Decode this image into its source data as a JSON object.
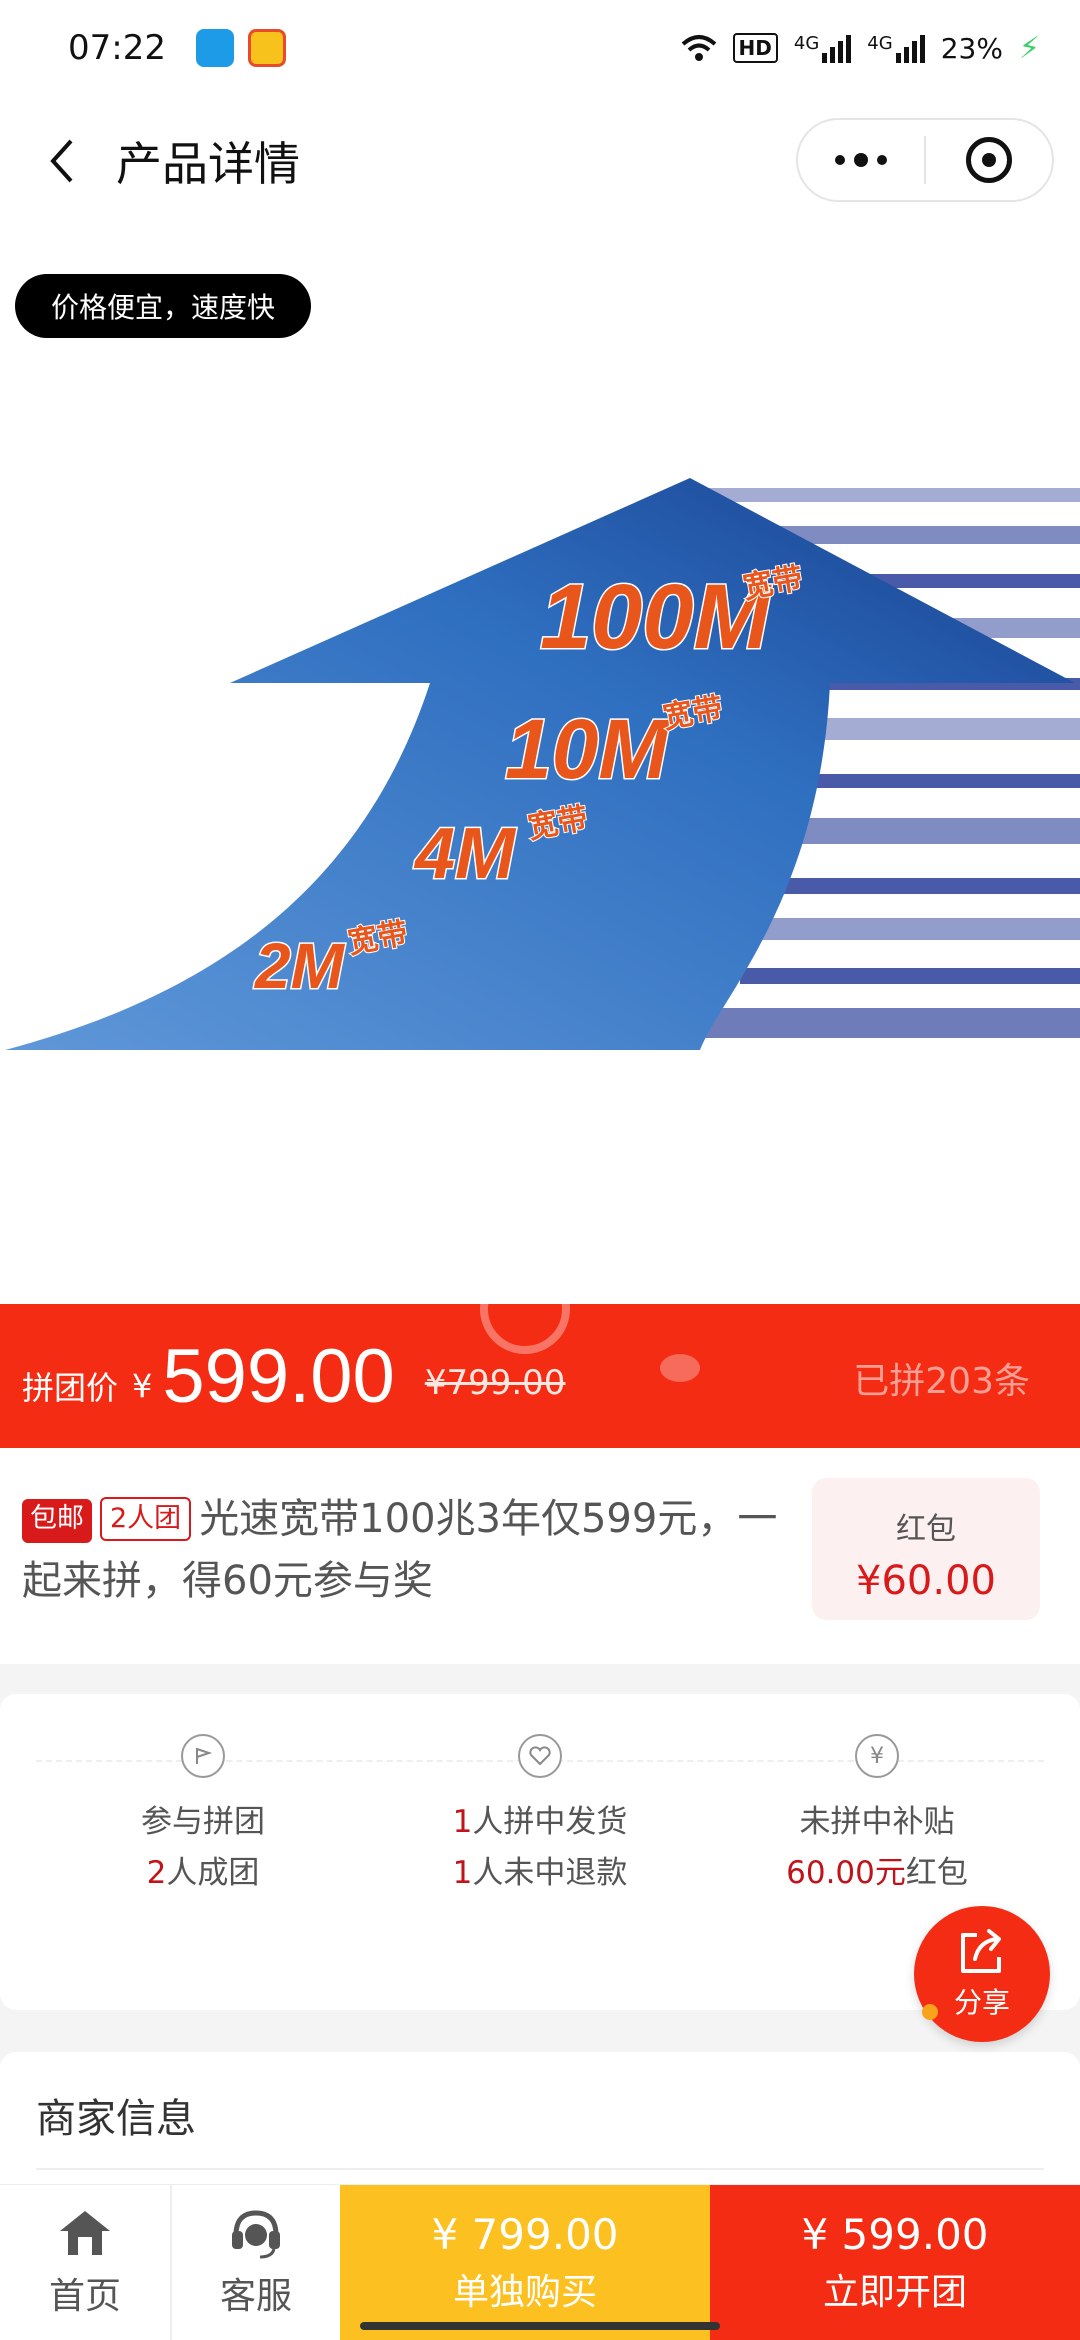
{
  "status": {
    "time": "07:22",
    "network": "4G",
    "battery": "23%"
  },
  "nav": {
    "title": "产品详情"
  },
  "product": {
    "tag": "价格便宜，速度快",
    "banner": {
      "speeds": [
        "100M",
        "10M",
        "4M",
        "2M"
      ],
      "suffix": "宽带"
    }
  },
  "price": {
    "label": "拼团价",
    "currency": "¥",
    "group_price": "599.00",
    "original_price": "¥799.00",
    "sold": "已拼203条"
  },
  "title": {
    "badge_free_ship": "包邮",
    "badge_group": "2人团",
    "text": "光速宽带100兆3年仅599元，一起来拼，得60元参与奖"
  },
  "red_packet": {
    "label": "红包",
    "amount": "¥60.00"
  },
  "rules": [
    {
      "icon": "flag-icon",
      "line1": "参与拼团",
      "line2_num": "2",
      "line2": "人成团"
    },
    {
      "icon": "heart-icon",
      "line1_num": "1",
      "line1": "人拼中发货",
      "line2_num": "1",
      "line2": "人未中退款"
    },
    {
      "icon": "yen-icon",
      "line1": "未拼中补贴",
      "line2_num": "60.00元",
      "line2": "红包"
    }
  ],
  "share": {
    "label": "分享"
  },
  "merchant": {
    "title": "商家信息"
  },
  "bottom": {
    "home": "首页",
    "service": "客服",
    "solo_price": "¥ 799.00",
    "solo_label": "单独购买",
    "group_price": "¥ 599.00",
    "group_label": "立即开团"
  },
  "colors": {
    "accent_red": "#f42c13",
    "yellow": "#fcc020",
    "badge_red": "#d81a1a"
  }
}
